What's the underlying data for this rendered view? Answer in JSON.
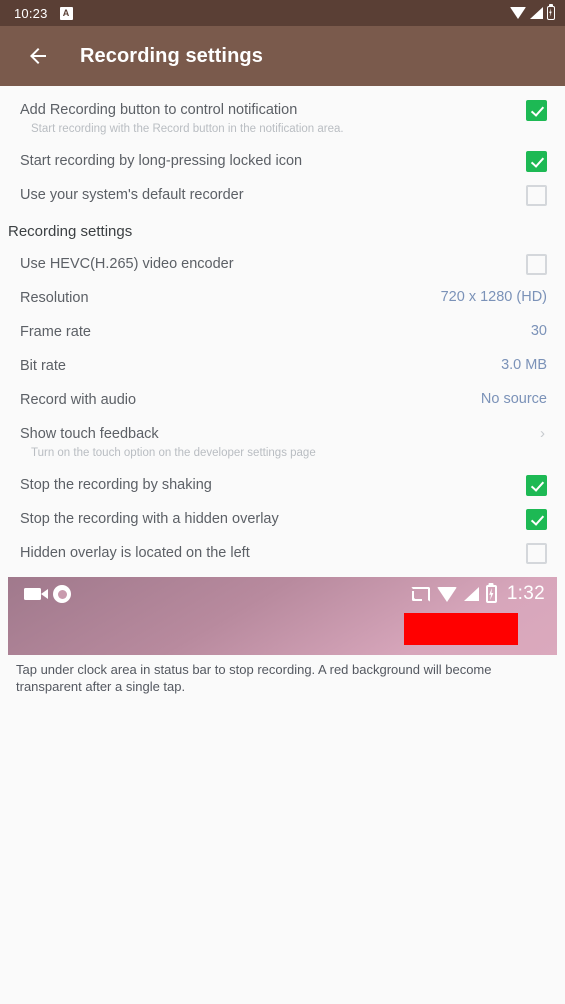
{
  "status_bar": {
    "clock": "10:23",
    "badge_letter": "A",
    "icons": [
      "wifi-icon",
      "signal-icon",
      "battery-icon"
    ]
  },
  "app_bar": {
    "back_icon": "arrow-left-icon",
    "title": "Recording settings"
  },
  "top_settings": [
    {
      "title": "Add Recording button to control notification",
      "subtitle": "Start recording with the Record button in the notification area.",
      "control": "checkbox",
      "checked": true
    },
    {
      "title": "Start recording by long-pressing locked icon",
      "subtitle": "",
      "control": "checkbox",
      "checked": true
    },
    {
      "title": "Use your system's default recorder",
      "subtitle": "",
      "control": "checkbox",
      "checked": false
    }
  ],
  "section": {
    "header": "Recording settings",
    "rows": [
      {
        "title": "Use HEVC(H.265) video encoder",
        "subtitle": "",
        "control": "checkbox",
        "checked": false,
        "value": ""
      },
      {
        "title": "Resolution",
        "subtitle": "",
        "control": "value",
        "checked": false,
        "value": "720 x 1280 (HD)"
      },
      {
        "title": "Frame rate",
        "subtitle": "",
        "control": "value",
        "checked": false,
        "value": "30"
      },
      {
        "title": "Bit rate",
        "subtitle": "",
        "control": "value",
        "checked": false,
        "value": "3.0 MB"
      },
      {
        "title": "Record with audio",
        "subtitle": "",
        "control": "value",
        "checked": false,
        "value": "No source"
      },
      {
        "title": "Show touch feedback",
        "subtitle": "Turn on the touch option on the developer settings page",
        "control": "chevron",
        "checked": false,
        "value": "›"
      },
      {
        "title": "Stop the recording by shaking",
        "subtitle": "",
        "control": "checkbox",
        "checked": true,
        "value": ""
      },
      {
        "title": "Stop the recording with a hidden overlay",
        "subtitle": "",
        "control": "checkbox",
        "checked": true,
        "value": ""
      },
      {
        "title": "Hidden overlay is located on the left",
        "subtitle": "",
        "control": "checkbox",
        "checked": false,
        "value": ""
      }
    ]
  },
  "illustration": {
    "left_icons": [
      "camcorder-icon",
      "record-circle-icon"
    ],
    "right_icons": [
      "cast-icon",
      "wifi-icon",
      "signal-icon",
      "battery-charging-icon"
    ],
    "time": "1:32",
    "highlight_color": "#ff0000",
    "caption": "Tap under clock area in status bar to stop recording. A red background will become transparent after a single tap."
  },
  "colors": {
    "status_bar": "#5a3f35",
    "app_bar": "#7a5a4c",
    "checkbox_on": "#1db954",
    "value_text": "#7b92b8",
    "page_bg": "#fafafa"
  }
}
